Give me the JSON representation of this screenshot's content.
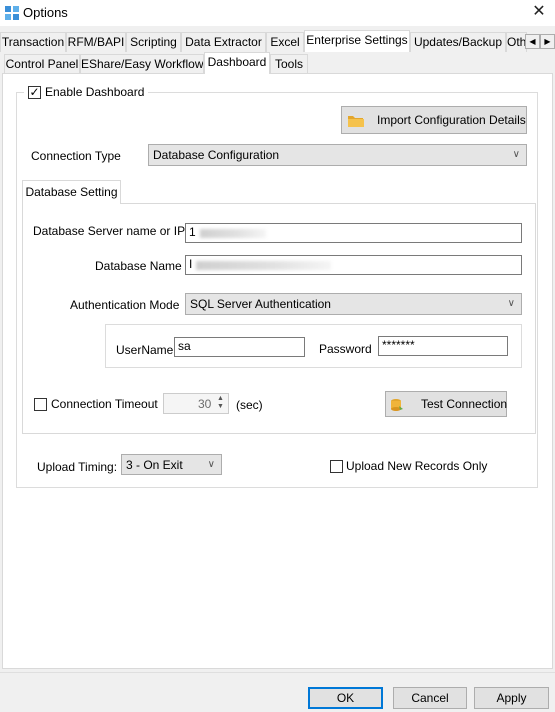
{
  "window": {
    "title": "Options",
    "close_glyph": "✕"
  },
  "tabs_row1": [
    "Transaction",
    "RFM/BAPI",
    "Scripting",
    "Data Extractor",
    "Excel",
    "Enterprise Settings",
    "Updates/Backup",
    "Oth"
  ],
  "tabs_row2": [
    "Control Panel",
    "EShare/Easy Workflow",
    "Dashboard",
    "Tools"
  ],
  "active_tab_row1": "Enterprise Settings",
  "active_tab_row2": "Dashboard",
  "dashboard": {
    "enable_label": "Enable Dashboard",
    "enable_checked": true,
    "import_button": "Import Configuration Details",
    "connection_type_label": "Connection Type",
    "connection_type_value": "Database Configuration",
    "subtab_label": "Database Setting",
    "server_label": "Database Server name or IP",
    "server_value": "1",
    "dbname_label": "Database Name",
    "dbname_value": "I",
    "auth_label": "Authentication Mode",
    "auth_value": "SQL Server Authentication",
    "username_label": "UserName",
    "username_value": "sa",
    "password_label": "Password",
    "password_value": "*******",
    "timeout_label": "Connection Timeout",
    "timeout_checked": false,
    "timeout_value": "30",
    "timeout_unit": "(sec)",
    "test_button": "Test Connection",
    "upload_timing_label": "Upload Timing:",
    "upload_timing_value": "3 - On Exit",
    "upload_new_label": "Upload New Records Only",
    "upload_new_checked": false
  },
  "footer": {
    "ok": "OK",
    "cancel": "Cancel",
    "apply": "Apply"
  },
  "colors": {
    "focus_border": "#0078d7",
    "window_bg": "#f0f0f0",
    "panel_bg": "#ffffff"
  }
}
